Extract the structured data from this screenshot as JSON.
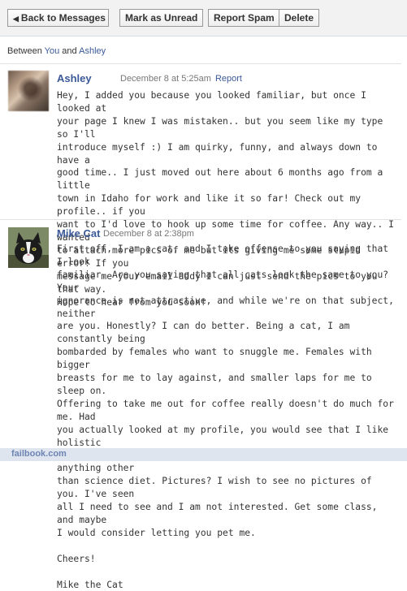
{
  "toolbar": {
    "back_label": "Back to Messages",
    "mark_unread_label": "Mark as Unread",
    "report_spam_label": "Report Spam",
    "delete_label": "Delete"
  },
  "participants": {
    "prefix": "Between",
    "first": "You",
    "conjunction": "and",
    "second": "Ashley"
  },
  "messages": [
    {
      "sender": "Ashley",
      "timestamp": "December 8 at 5:25am",
      "report_label": "Report",
      "body": "Hey, I added you because you looked familiar, but once I looked at\nyour page I knew I was mistaken.. but you seem like my type so I'll\nintroduce myself :) I am quirky, funny, and always down to have a\ngood time.. I just moved out here about 6 months ago from a little\ntown in Idaho for work and like it so far! Check out my profile.. if you\nwant to I'd love to hook up some time for coffee. Any way.. I wanted\nto attach more pics of me but its giving me some stupid error! If you\nmessage me your email addy I can just send the pics to you that way.\nHope to hear from you soon!"
    },
    {
      "sender": "Mike Cat",
      "timestamp": "December 8 at 2:38pm",
      "body": "First off, I am a cat, and I take offense to you saying that I look\nfamiliar. Are you saying that all cats look the same to you? Your\nignorance is not attractive, and while we're on that subject, neither\nare you. Honestly? I can do better. Being a cat, I am constantly being\nbombarded by females who want to snuggle me. Females with bigger\nbreasts for me to lay against, and smaller laps for me to sleep on.\nOffering to take me out for coffee really doesn't do much for me. Had\nyou actually looked at my profile, you would see that I like holistic\nfoods and am not interested in polluting my body with anything other\nthan science diet. Pictures? I wish to see no pictures of you. I've seen\nall I need to see and I am not interested. Get some class, and maybe\nI would consider letting you pet me.\n\nCheers!\n\nMike the Cat"
    }
  ],
  "watermark": "failbook.com",
  "colors": {
    "link": "#3b5998",
    "toolbar_bg": "#f2f2f2",
    "footer_bg": "#dfe5ee"
  }
}
